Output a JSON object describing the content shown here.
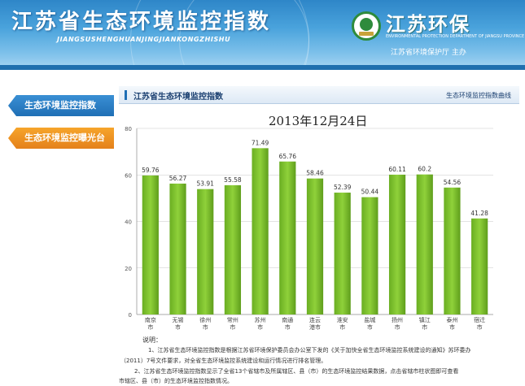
{
  "header": {
    "title": "江苏省生态环境监控指数",
    "subtitle": "JIANGSUSHENGHUANJINGJIANKONGZHISHU",
    "brand_name": "江苏环保",
    "brand_dept_en": "ENVIRONMENTAL PROTECTION DEPARTMENT OF JIANGSU PROVINCE",
    "brand_host": "江苏省环境保护厅  主办",
    "logo_icon": "environmental-protection-emblem-icon",
    "colors": {
      "banner": "#2e86c8",
      "nav_blue": "#1f6fb5",
      "nav_orange": "#e4811b",
      "bar": "#7bbf2a"
    }
  },
  "nav": {
    "items": [
      {
        "label": "生态环境监控指数"
      },
      {
        "label": "生态环境监控曝光台"
      }
    ]
  },
  "panel": {
    "title": "江苏省生态环境监控指数",
    "link": "生态环境监控指数曲线"
  },
  "chart_data": {
    "type": "bar",
    "title": "2013年12月24日",
    "categories": [
      "南京市",
      "无锡市",
      "徐州市",
      "常州市",
      "苏州市",
      "南通市",
      "连云港市",
      "淮安市",
      "盐城市",
      "扬州市",
      "镇江市",
      "泰州市",
      "宿迁市"
    ],
    "category_lines": [
      [
        "南京",
        "市"
      ],
      [
        "无锡",
        "市"
      ],
      [
        "徐州",
        "市"
      ],
      [
        "常州",
        "市"
      ],
      [
        "苏州",
        "市"
      ],
      [
        "南通",
        "市"
      ],
      [
        "连云",
        "港市"
      ],
      [
        "淮安",
        "市"
      ],
      [
        "盐城",
        "市"
      ],
      [
        "扬州",
        "市"
      ],
      [
        "镇江",
        "市"
      ],
      [
        "泰州",
        "市"
      ],
      [
        "宿迁",
        "市"
      ]
    ],
    "values": [
      59.76,
      56.27,
      53.91,
      55.58,
      71.49,
      65.76,
      58.46,
      52.39,
      50.44,
      60.11,
      60.2,
      54.56,
      41.28
    ],
    "value_labels": [
      "59.76",
      "56.27",
      "53.91",
      "55.58",
      "71.49",
      "65.76",
      "58.46",
      "52.39",
      "50.44",
      "60.11",
      "60.2",
      "54.56",
      "41.28"
    ],
    "ylim": [
      0,
      80
    ],
    "yticks": [
      "0",
      "20",
      "40",
      "60",
      "80"
    ],
    "grid": true,
    "xlabel": "",
    "ylabel": ""
  },
  "notes": {
    "title": "说明：",
    "lines": [
      "1、江苏省生态环境监控指数是根据江苏省环境保护委员会办公室下发的《关于加快全省生态环境监控系统建设的通知》苏环委办",
      "（2011）7号文件要求，对全省生态环境监控系统建设和运行情况进行排名管理。",
      "2、江苏省生态环境监控指数显示了全省13个省辖市及所属辖区、县（市）的生态环境监控结果数据，点击省辖市柱状图即可查看",
      "市辖区、县（市）的生态环境监控指数情况。"
    ]
  }
}
